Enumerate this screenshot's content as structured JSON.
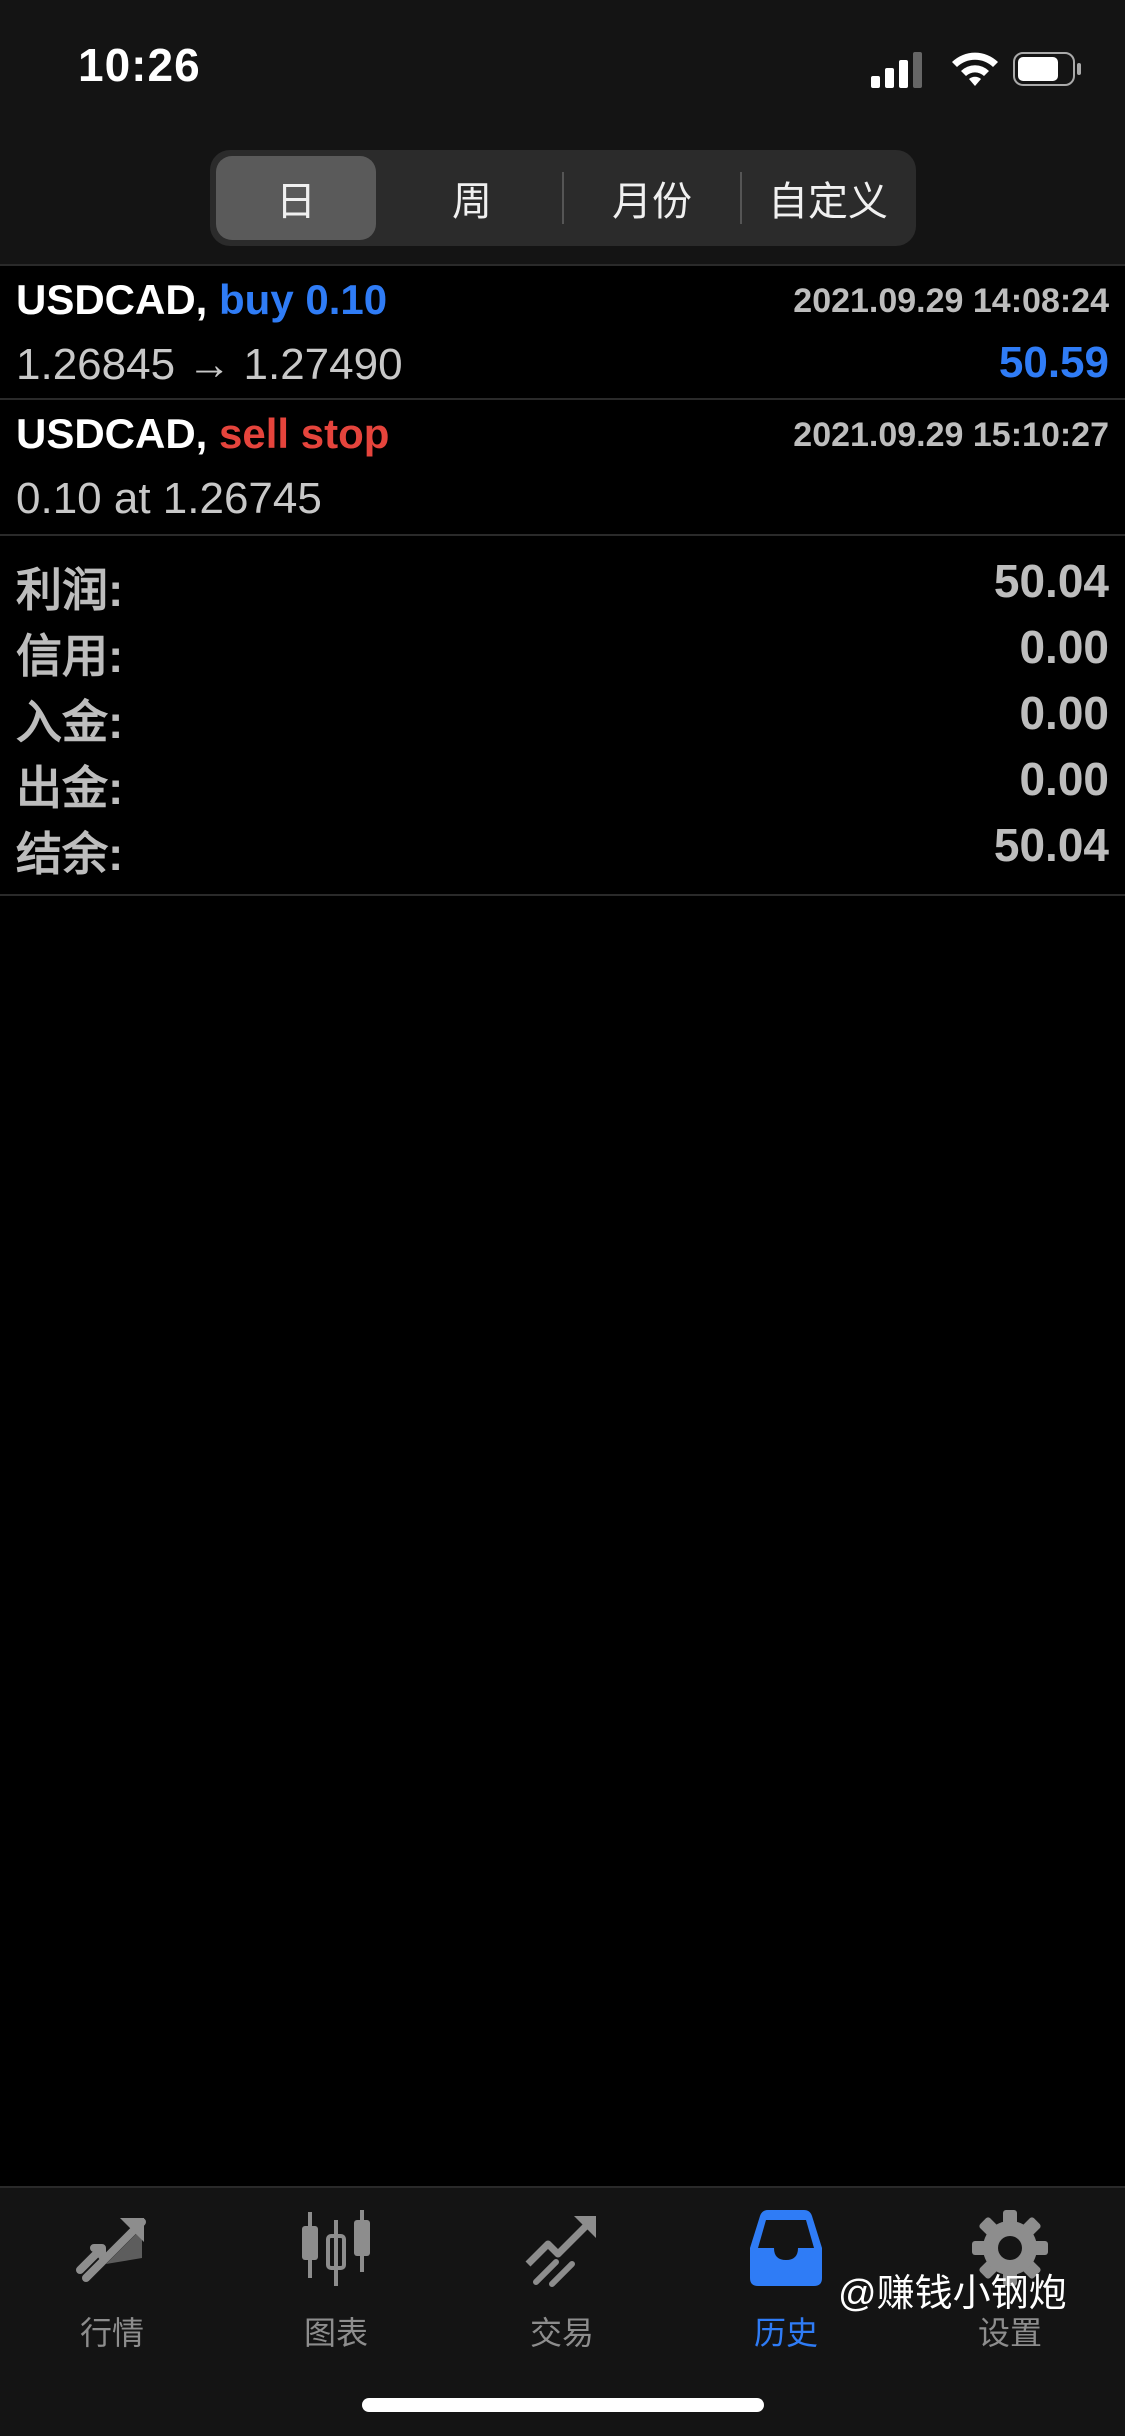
{
  "status_bar": {
    "time": "10:26"
  },
  "segments": [
    {
      "label": "日",
      "active": true
    },
    {
      "label": "周",
      "active": false
    },
    {
      "label": "月份",
      "active": false
    },
    {
      "label": "自定义",
      "active": false
    }
  ],
  "deals": [
    {
      "symbol": "USDCAD,",
      "action": "buy 0.10",
      "action_color": "#2f7cf6",
      "time": "2021.09.29 14:08:24",
      "sub": "1.26845 → 1.27490",
      "profit": "50.59"
    },
    {
      "symbol": "USDCAD,",
      "action": "sell stop",
      "action_color": "#e5443c",
      "time": "2021.09.29 15:10:27",
      "sub": "0.10 at 1.26745",
      "profit": ""
    }
  ],
  "summary": [
    {
      "label": "利润:",
      "value": "50.04"
    },
    {
      "label": "信用:",
      "value": "0.00"
    },
    {
      "label": "入金:",
      "value": "0.00"
    },
    {
      "label": "出金:",
      "value": "0.00"
    },
    {
      "label": "结余:",
      "value": "50.04"
    }
  ],
  "tabs": [
    {
      "label": "行情",
      "icon": "quotes-arrows-icon",
      "active": false
    },
    {
      "label": "图表",
      "icon": "candlestick-chart-icon",
      "active": false
    },
    {
      "label": "交易",
      "icon": "trade-chart-icon",
      "active": false
    },
    {
      "label": "历史",
      "icon": "inbox-history-icon",
      "active": true
    },
    {
      "label": "设置",
      "icon": "gear-icon",
      "active": false
    }
  ],
  "watermark": "@赚钱小钢炮",
  "colors": {
    "accent": "#2f7cf6",
    "sell": "#e5443c",
    "inactive": "#8d8d8d"
  }
}
